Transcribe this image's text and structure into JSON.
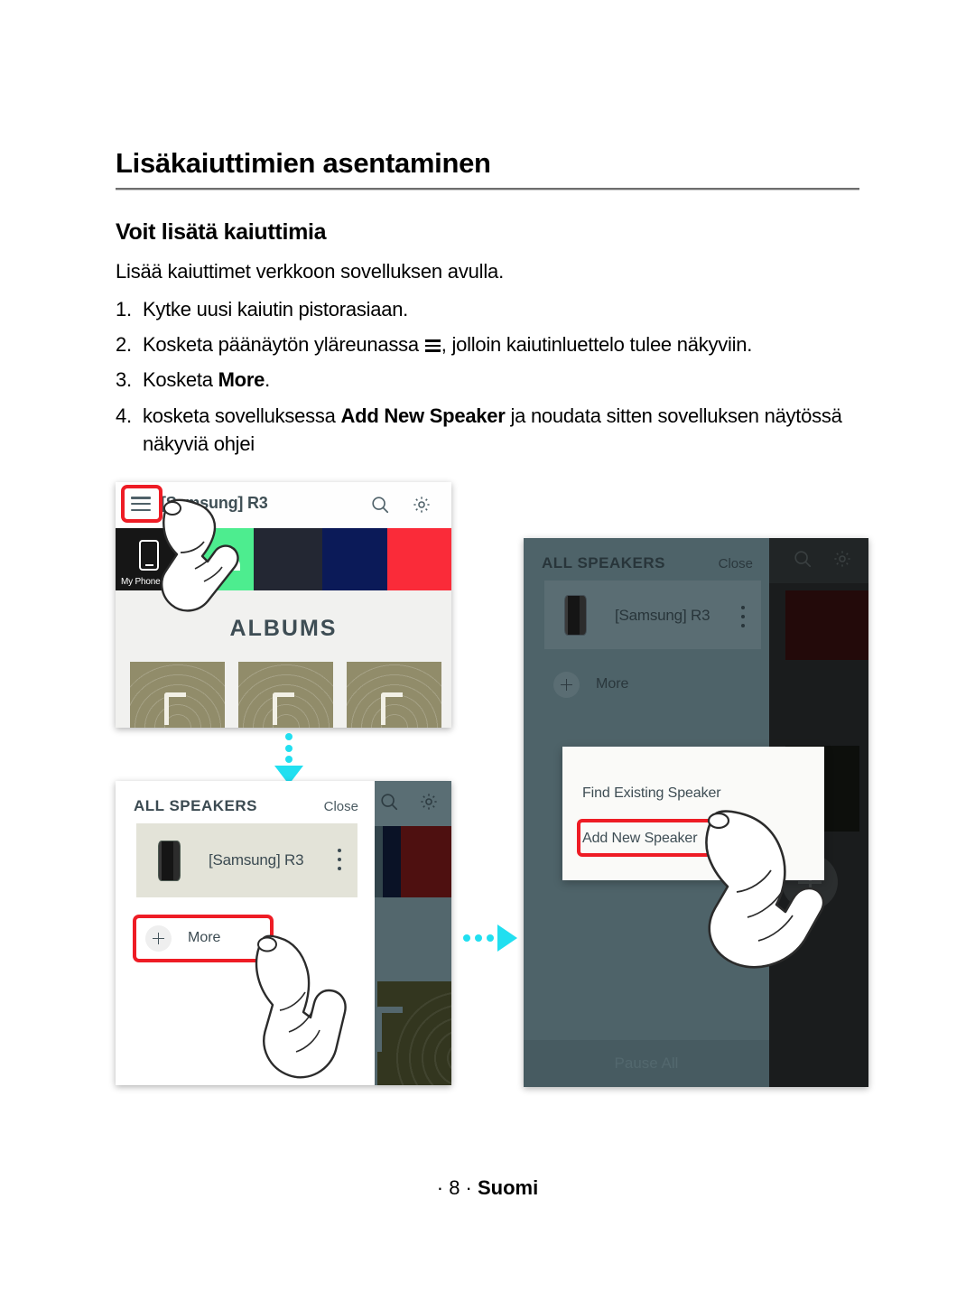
{
  "document": {
    "title": "Lisäkaiuttimien asentaminen",
    "subtitle": "Voit lisätä kaiuttimia",
    "lead": "Lisää kaiuttimet verkkoon sovelluksen avulla.",
    "footer_page": "· 8 · ",
    "footer_language": "Suomi"
  },
  "steps": [
    {
      "num": "1.",
      "text_before": "Kytke uusi kaiutin pistorasiaan.",
      "bold": "",
      "text_after": "",
      "has_icon": false
    },
    {
      "num": "2.",
      "text_before": "Kosketa päänäytön yläreunassa ",
      "bold": "",
      "text_after": ", jolloin kaiutinluettelo tulee näkyviin.",
      "has_icon": true
    },
    {
      "num": "3.",
      "text_before": "Kosketa ",
      "bold": "More",
      "text_after": ".",
      "has_icon": false
    },
    {
      "num": "4.",
      "text_before": "kosketa sovelluksessa ",
      "bold": "Add New Speaker",
      "text_after": " ja noudata sitten sovelluksen näytössä näkyviä ohjei",
      "has_icon": false
    }
  ],
  "shot_a": {
    "appbar_title": "[Samsung] R3",
    "my_phone_label": "My Phone",
    "albums_heading": "ALBUMS",
    "icons": {
      "menu": "hamburger-icon",
      "search": "search-icon",
      "settings": "gear-icon"
    }
  },
  "shot_b": {
    "panel_heading": "ALL SPEAKERS",
    "close_label": "Close",
    "speaker_name": "[Samsung] R3",
    "more_label": "More"
  },
  "shot_c": {
    "panel_heading": "ALL SPEAKERS",
    "close_label": "Close",
    "speaker_name": "[Samsung] R3",
    "more_label": "More",
    "pause_all_label": "Pause All",
    "background_more_label": "More",
    "dialog": {
      "option_find": "Find Existing Speaker",
      "option_add": "Add New Speaker"
    }
  },
  "colors": {
    "highlight": "#ee1c25",
    "arrow": "#21dff0",
    "panel_text": "#3c4b52",
    "tile_green": "#4ded8f",
    "tile_dark": "#232733",
    "tile_navy": "#0b1a58",
    "tile_red": "#fa2b39"
  }
}
